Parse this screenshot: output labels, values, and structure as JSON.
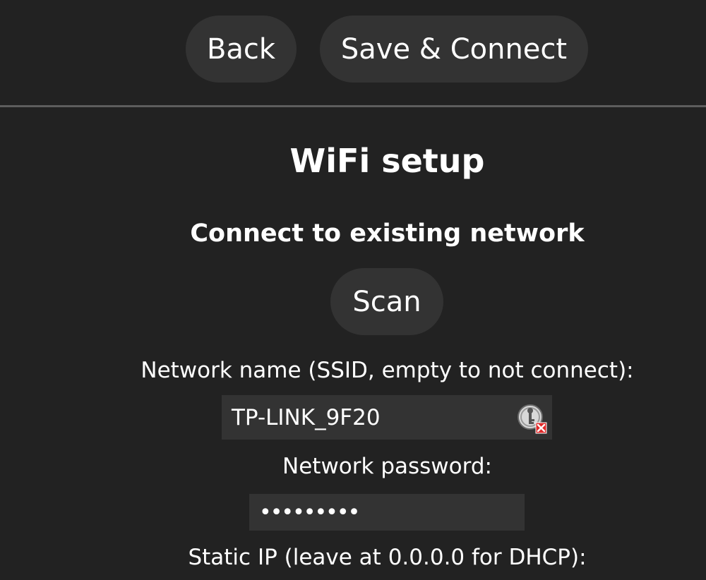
{
  "toolbar": {
    "back_label": "Back",
    "save_label": "Save & Connect"
  },
  "page": {
    "title": "WiFi setup",
    "subtitle": "Connect to existing network",
    "scan_label": "Scan"
  },
  "form": {
    "ssid_label": "Network name (SSID, empty to not connect):",
    "ssid_value": "TP-LINK_9F20",
    "password_label": "Network password:",
    "password_value": "•••••••••",
    "static_ip_label": "Static IP (leave at 0.0.0.0 for DHCP):"
  },
  "icons": {
    "password_manager": "key-icon"
  },
  "colors": {
    "background": "#222222",
    "button": "#333333",
    "field": "#333333",
    "divider": "#5d5d5d",
    "text": "#ffffff",
    "badge": "#e02a2a"
  }
}
